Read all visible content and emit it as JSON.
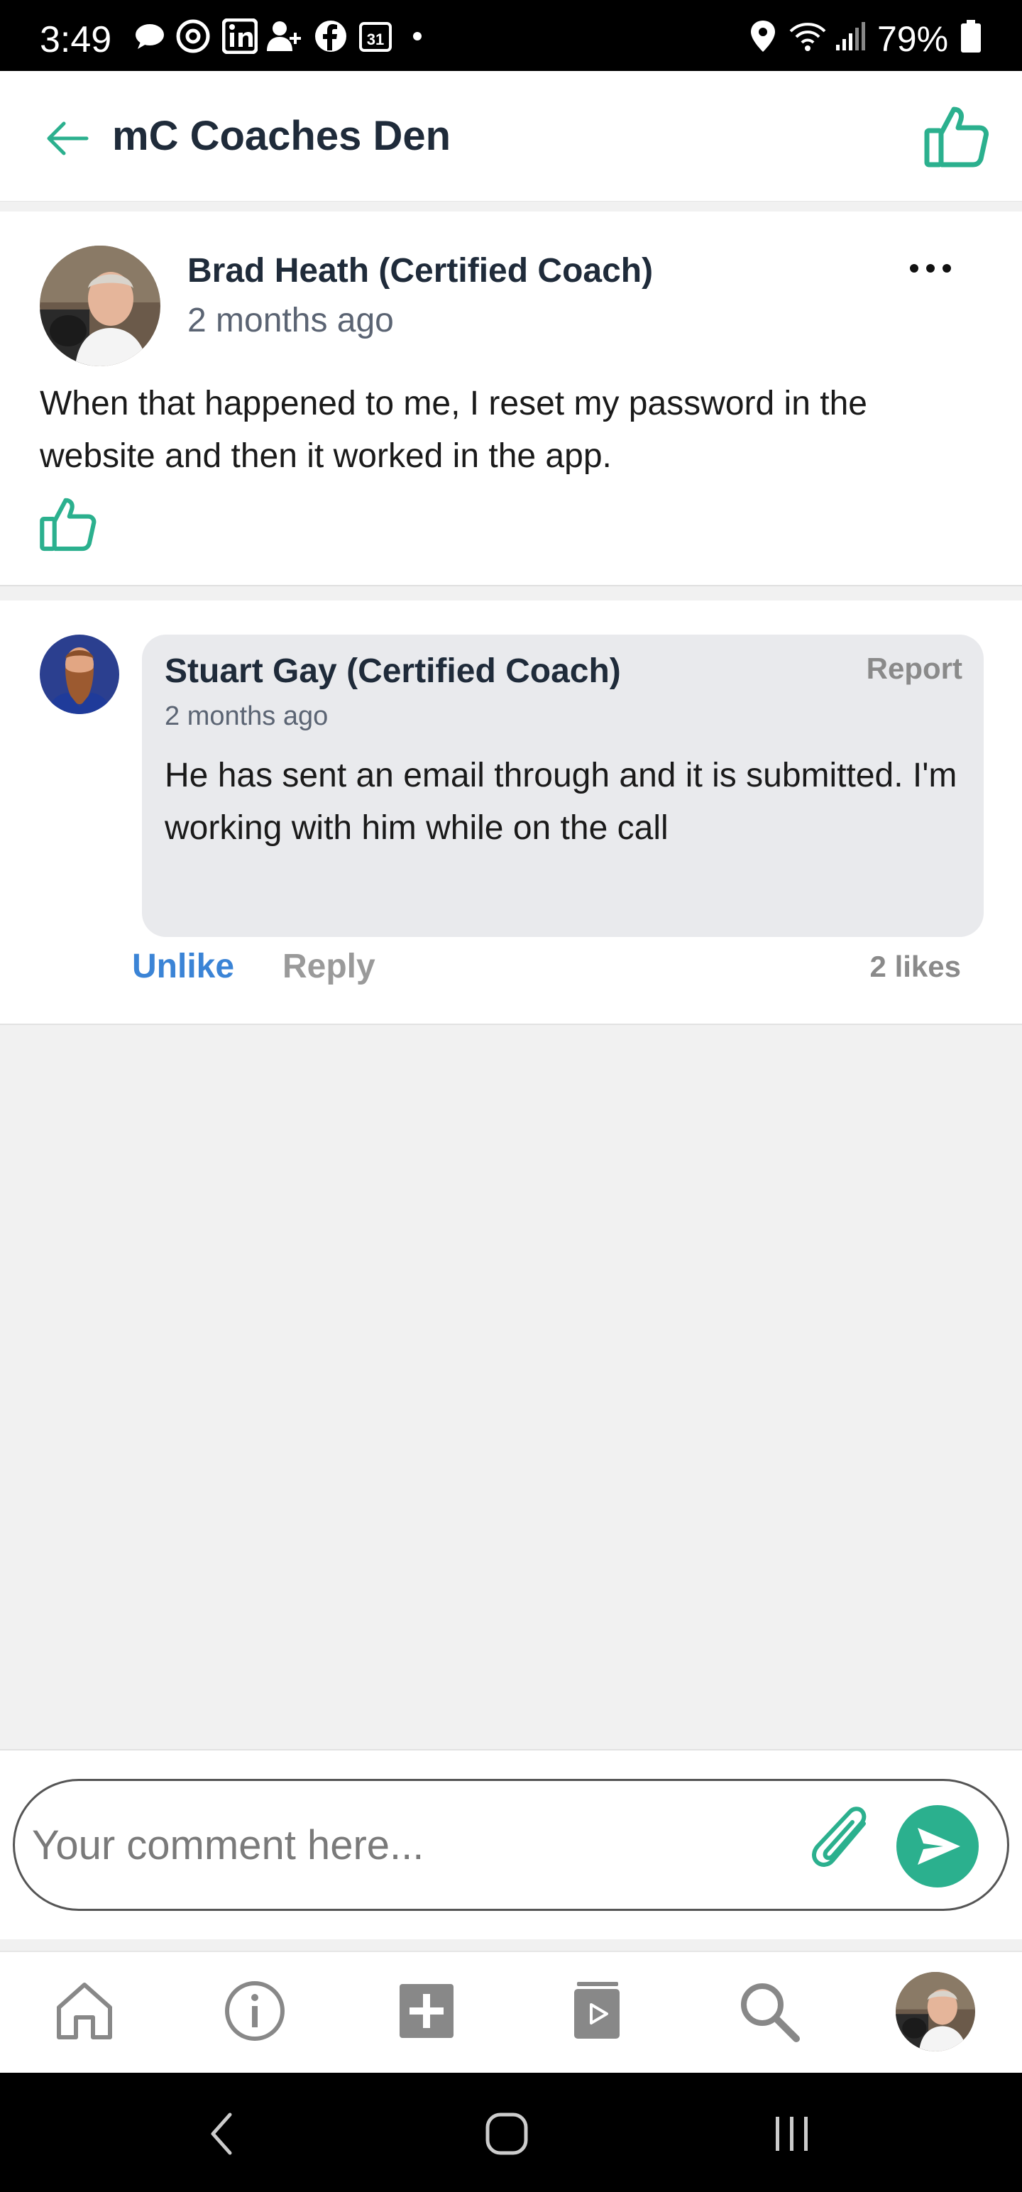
{
  "status_bar": {
    "time": "3:49",
    "battery": "79%",
    "icons": [
      "chat-bubble-icon",
      "threads-icon",
      "linkedin-icon",
      "add-person-icon",
      "facebook-icon",
      "calendar-icon",
      "dot-icon",
      "location-icon",
      "wifi-icon",
      "signal-icon",
      "battery-icon"
    ],
    "calendar_day": "31"
  },
  "header": {
    "title": "mC Coaches Den",
    "back_icon": "arrow-left-icon",
    "like_icon": "thumbs-up-icon"
  },
  "post": {
    "author": "Brad Heath (Certified Coach)",
    "time": "2 months ago",
    "body": "When that happened to me, I reset my password in the website and then it worked in the app.",
    "more_icon": "more-horizontal-icon"
  },
  "comment": {
    "author": "Stuart Gay (Certified Coach)",
    "time": "2 months ago",
    "body": "He has sent an email through and it is submitted. I'm working with him while on the call",
    "report_label": "Report",
    "unlike_label": "Unlike",
    "reply_label": "Reply",
    "likes": "2 likes"
  },
  "composer": {
    "placeholder": "Your comment here..."
  },
  "bottom_nav": {
    "items": [
      "home-icon",
      "info-icon",
      "add-icon",
      "library-icon",
      "search-icon",
      "profile-avatar"
    ]
  },
  "colors": {
    "accent": "#2bb08e",
    "link": "#3b84d6",
    "muted": "#8a8a8a"
  }
}
